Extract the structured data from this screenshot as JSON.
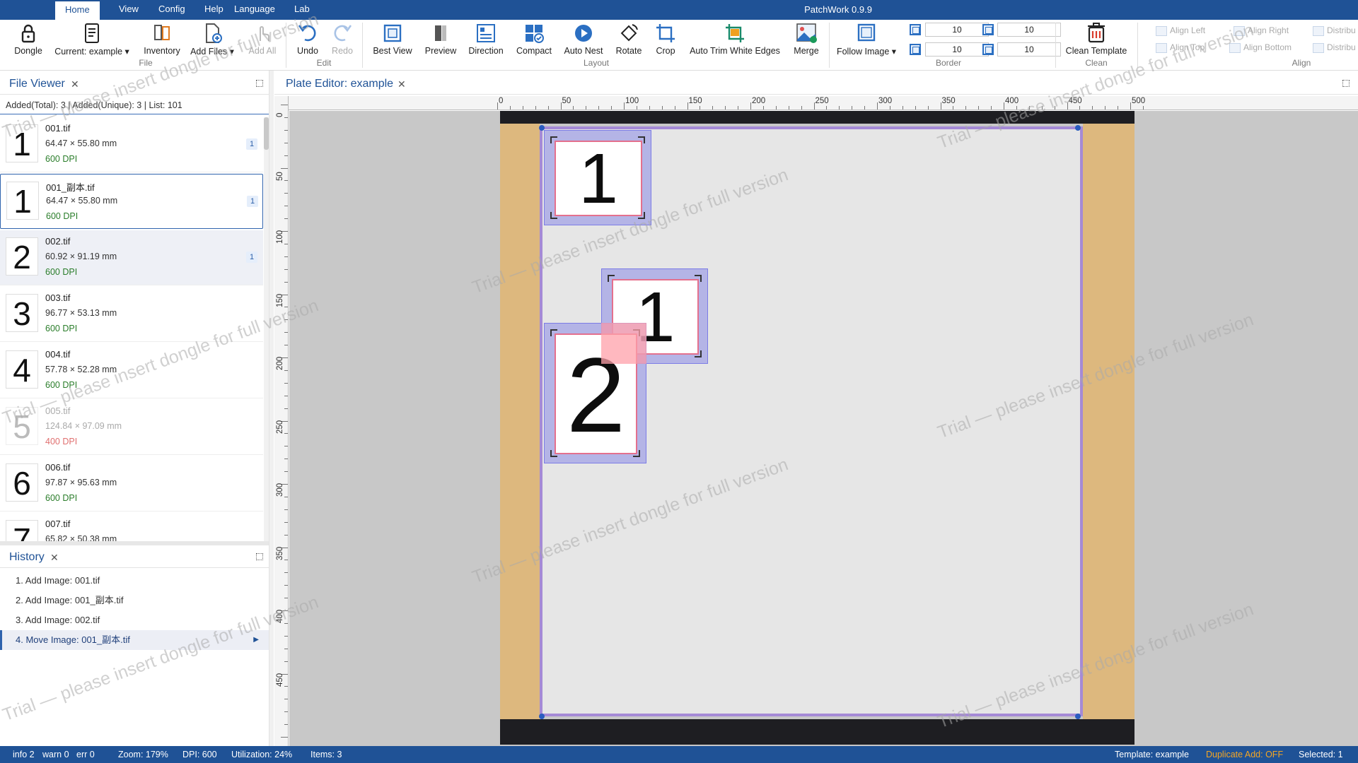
{
  "menubar": {
    "items": [
      "Home",
      "View",
      "Config",
      "Help",
      "Language",
      "Lab"
    ],
    "active": "Home",
    "app_title": "PatchWork 0.9.9"
  },
  "ribbon": {
    "file": {
      "group_label": "File",
      "dongle": "Dongle",
      "current": "Current: example",
      "inventory": "Inventory",
      "add_files": "Add Files",
      "add_all": "Add All"
    },
    "edit": {
      "group_label": "Edit",
      "undo": "Undo",
      "redo": "Redo"
    },
    "layout": {
      "group_label": "Layout",
      "best_view": "Best View",
      "preview": "Preview",
      "direction": "Direction",
      "compact": "Compact",
      "auto_nest": "Auto Nest",
      "rotate": "Rotate",
      "crop": "Crop",
      "auto_trim": "Auto Trim White Edges",
      "merge": "Merge"
    },
    "border": {
      "group_label": "Border",
      "follow_image": "Follow Image",
      "top_left": "10",
      "top_right": "10",
      "bottom_left": "10",
      "bottom_right": "10"
    },
    "clean": {
      "group_label": "Clean",
      "clean_template": "Clean Template"
    },
    "align": {
      "group_label": "Align",
      "align_left": "Align Left",
      "align_right": "Align Right",
      "distribute_1": "Distribu",
      "align_top": "Align Top",
      "align_bottom": "Align Bottom",
      "distribute_2": "Distribu"
    }
  },
  "file_viewer": {
    "title": "File Viewer",
    "stats": "Added(Total): 3 | Added(Unique): 3 | List: 101",
    "files": [
      {
        "thumb": "1",
        "name": "001.tif",
        "size": "64.47 × 55.80 mm",
        "dpi": "600 DPI",
        "badge": "1"
      },
      {
        "thumb": "1",
        "name": "001_副本.tif",
        "size": "64.47 × 55.80 mm",
        "dpi": "600 DPI",
        "badge": "1"
      },
      {
        "thumb": "2",
        "name": "002.tif",
        "size": "60.92 × 91.19 mm",
        "dpi": "600 DPI",
        "badge": "1"
      },
      {
        "thumb": "3",
        "name": "003.tif",
        "size": "96.77 × 53.13 mm",
        "dpi": "600 DPI",
        "badge": ""
      },
      {
        "thumb": "4",
        "name": "004.tif",
        "size": "57.78 × 52.28 mm",
        "dpi": "600 DPI",
        "badge": ""
      },
      {
        "thumb": "5",
        "name": "005.tif",
        "size": "124.84 × 97.09 mm",
        "dpi": "400 DPI",
        "badge": ""
      },
      {
        "thumb": "6",
        "name": "006.tif",
        "size": "97.87 × 95.63 mm",
        "dpi": "600 DPI",
        "badge": ""
      },
      {
        "thumb": "7",
        "name": "007.tif",
        "size": "65.82 × 50.38 mm",
        "dpi": "",
        "badge": ""
      }
    ]
  },
  "history": {
    "title": "History",
    "items": [
      "1. Add Image: 001.tif",
      "2. Add Image: 001_副本.tif",
      "3. Add Image: 002.tif",
      "4. Move Image: 001_副本.tif"
    ]
  },
  "editor": {
    "title": "Plate Editor: example",
    "ruler_h": [
      "0",
      "50",
      "100",
      "150",
      "200",
      "250",
      "300",
      "350",
      "400",
      "450",
      "500"
    ],
    "ruler_v": [
      "0",
      "50",
      "100",
      "150",
      "200",
      "250",
      "300",
      "350",
      "400",
      "450",
      "500"
    ],
    "placed": [
      {
        "label": "1"
      },
      {
        "label": "1"
      },
      {
        "label": "2"
      }
    ],
    "watermark": "Trial — please insert dongle for full version"
  },
  "status": {
    "info": "info 2",
    "warn": "warn 0",
    "err": "err 0",
    "zoom": "Zoom: 179%",
    "dpi": "DPI: 600",
    "utilization": "Utilization: 24%",
    "items": "Items: 3",
    "template": "Template: example",
    "duplicate": "Duplicate Add: OFF",
    "selected": "Selected: 1"
  },
  "colors": {
    "brand": "#1f5296",
    "plate_margin": "#ddb87e",
    "selection": "#7c7ce6",
    "duplicate_off": "#f5a623"
  }
}
